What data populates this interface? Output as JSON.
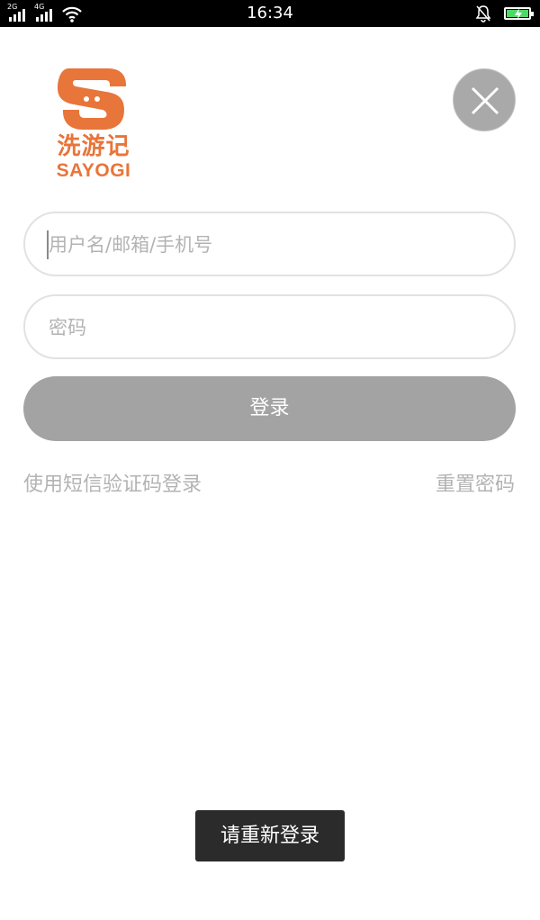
{
  "status_bar": {
    "network_1": "2G",
    "network_2": "4G",
    "time": "16:34",
    "icons": [
      "signal-icon",
      "signal-icon",
      "wifi-icon",
      "mute-bell-icon",
      "battery-charging-icon"
    ]
  },
  "logo": {
    "chinese_name": "洗游记",
    "english_name": "SAYOGI",
    "brand_color": "#e8753a"
  },
  "close_button": {
    "icon": "close-icon"
  },
  "form": {
    "username_placeholder": "用户名/邮箱/手机号",
    "password_placeholder": "密码",
    "login_label": "登录"
  },
  "links": {
    "sms_login": "使用短信验证码登录",
    "reset_password": "重置密码"
  },
  "toast": {
    "message": "请重新登录"
  }
}
